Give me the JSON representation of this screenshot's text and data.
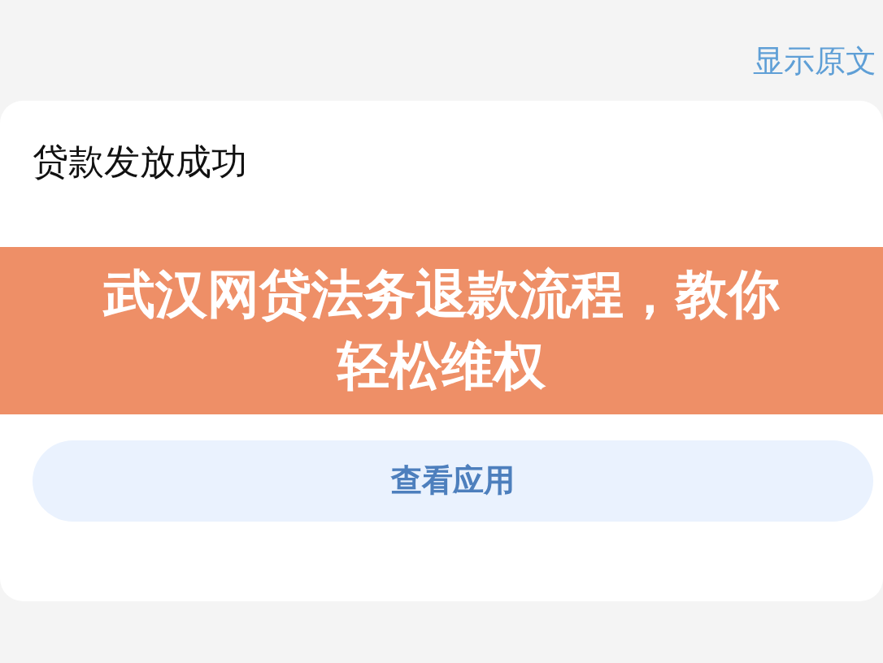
{
  "header": {
    "link": "显示原文"
  },
  "card": {
    "title": "贷款发放成功",
    "button": "查看应用"
  },
  "banner": {
    "title": "武汉网贷法务退款流程，教你轻松维权"
  }
}
